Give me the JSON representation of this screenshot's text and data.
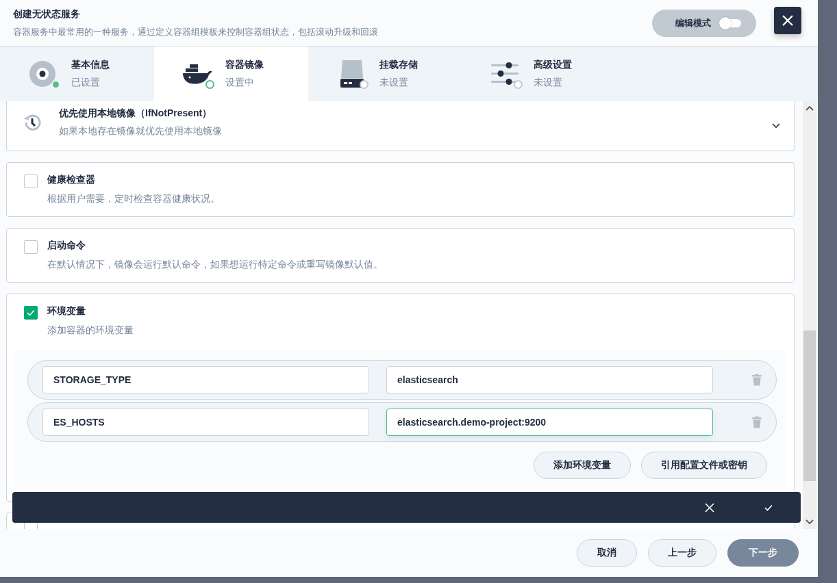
{
  "header": {
    "title": "创建无状态服务",
    "subtitle": "容器服务中最常用的一种服务，通过定义容器组模板来控制容器组状态，包括滚动升级和回滚",
    "edit_mode": {
      "label": "编辑模式",
      "on": false
    }
  },
  "steps": [
    {
      "title": "基本信息",
      "status": "已设置",
      "selected": false,
      "completed": true,
      "in_progress": false,
      "kind": "disc"
    },
    {
      "title": "容器镜像",
      "status": "设置中",
      "selected": true,
      "completed": false,
      "in_progress": true,
      "kind": "whale"
    },
    {
      "title": "挂载存储",
      "status": "未设置",
      "selected": false,
      "completed": false,
      "in_progress": false,
      "kind": "drive"
    },
    {
      "title": "高级设置",
      "status": "未设置",
      "selected": false,
      "completed": false,
      "in_progress": false,
      "kind": "sliders"
    }
  ],
  "pull_policy": {
    "title": "优先使用本地镜像（IfNotPresent）",
    "description": "如果本地存在镜像就优先使用本地镜像",
    "expanded": false
  },
  "options": [
    {
      "title": "健康检查器",
      "description": "根据用户需要，定时检查容器健康状况。",
      "checked": false
    },
    {
      "title": "启动命令",
      "description": "在默认情况下，镜像会运行默认命令，如果想运行特定命令或重写镜像默认值。",
      "checked": false
    },
    {
      "title": "环境变量",
      "description": "添加容器的环境变量",
      "checked": true
    }
  ],
  "env_vars": [
    {
      "name": "STORAGE_TYPE",
      "value": "elasticsearch",
      "focused": false
    },
    {
      "name": "ES_HOSTS",
      "value": "elasticsearch.demo-project:9200",
      "focused": true
    }
  ],
  "env_actions": [
    "添加环境变量",
    "引用配置文件或密钥"
  ],
  "partial_option": {
    "checked": false
  },
  "footer": {
    "buttons": [
      {
        "label": "取消",
        "primary": false
      },
      {
        "label": "上一步",
        "primary": false
      },
      {
        "label": "下一步",
        "primary": true
      }
    ]
  }
}
